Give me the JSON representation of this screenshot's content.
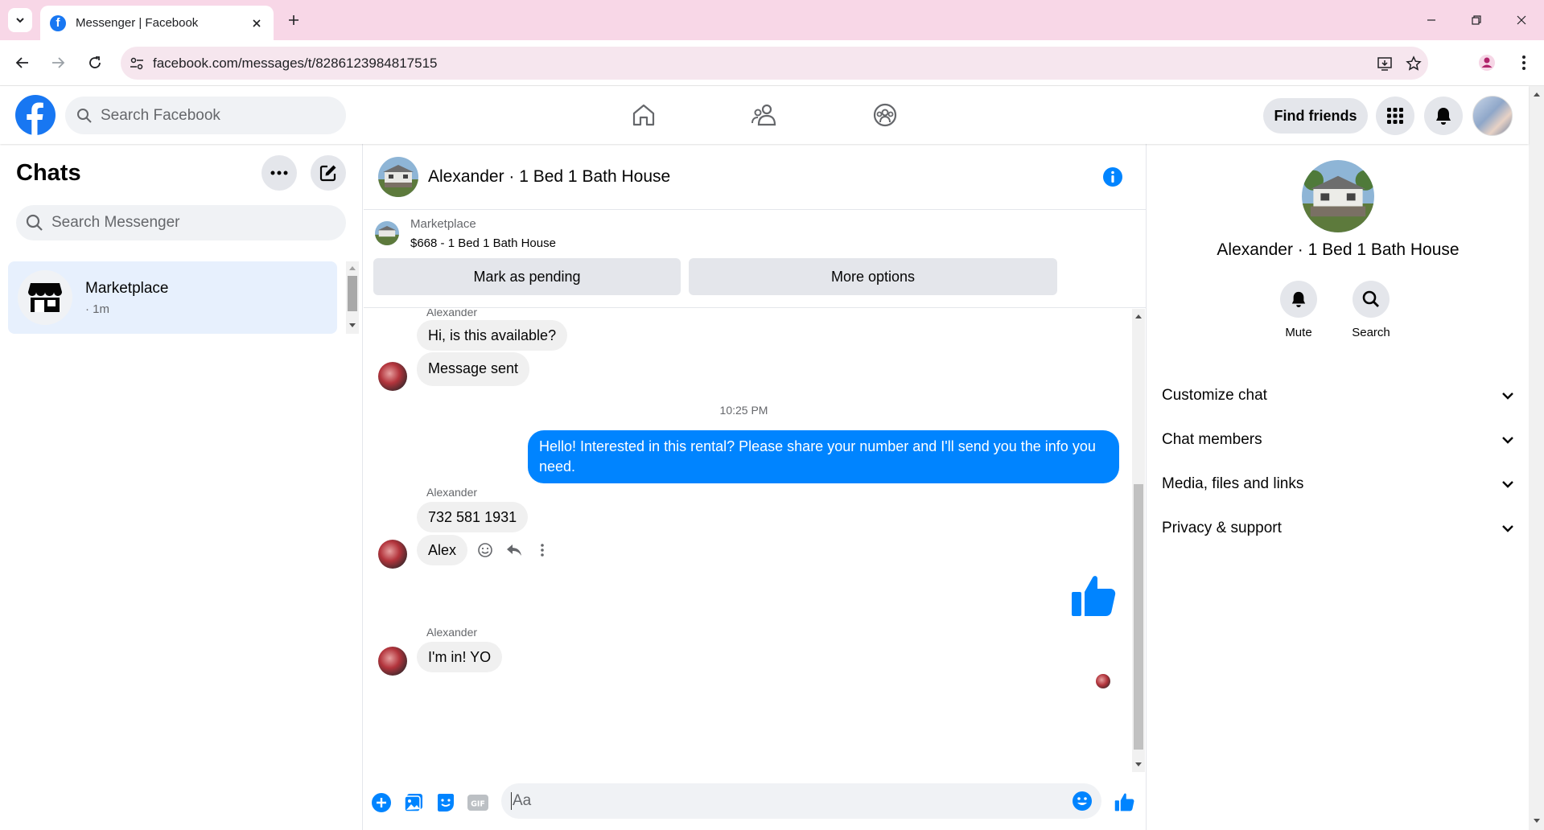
{
  "browser": {
    "tab_title": "Messenger | Facebook",
    "url": "facebook.com/messages/t/8286123984817515"
  },
  "fb_header": {
    "search_placeholder": "Search Facebook",
    "find_friends_label": "Find friends"
  },
  "chats": {
    "title": "Chats",
    "search_placeholder": "Search Messenger",
    "items": [
      {
        "name": "Marketplace",
        "time": "· 1m"
      }
    ]
  },
  "conversation": {
    "title": "Alexander · 1 Bed 1 Bath House",
    "marketplace_label": "Marketplace",
    "listing": "$668 - 1 Bed 1 Bath House",
    "mark_pending_label": "Mark as pending",
    "more_options_label": "More options",
    "messages": {
      "sender1": "Alexander",
      "m1": "Hi, is this available?",
      "m2": "Message sent",
      "timestamp": "10:25 PM",
      "out1": "Hello! Interested in this rental? Please share your number and I'll send you the info you need.",
      "sender2": "Alexander",
      "m3": "732 581 1931",
      "m4": "Alex",
      "sender3": "Alexander",
      "m5": "I'm in! YO"
    },
    "composer_placeholder": "Aa"
  },
  "details": {
    "name": "Alexander · 1 Bed 1 Bath House",
    "mute_label": "Mute",
    "search_label": "Search",
    "sections": [
      "Customize chat",
      "Chat members",
      "Media, files and links",
      "Privacy & support"
    ]
  },
  "colors": {
    "messenger_blue": "#0084ff",
    "fb_blue": "#1877f2",
    "tab_strip": "#f8d7e7",
    "selected_chat": "#e7f0fd"
  }
}
